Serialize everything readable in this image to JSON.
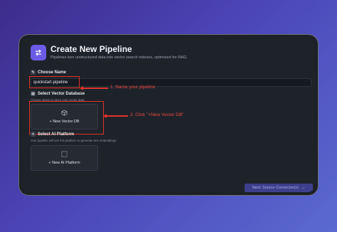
{
  "header": {
    "title": "Create New Pipeline",
    "subtitle": "Pipelines turn unstructured data into vector search indexes, optimized for RAG.",
    "icon": "swap-arrows-icon"
  },
  "name_section": {
    "label": "Choose Name",
    "value": "quickstart-pipeline"
  },
  "vector_section": {
    "label": "Select Vector Database",
    "help": "Choose where to store your vector data.",
    "card_label": "+ New Vector DB"
  },
  "ai_section": {
    "label": "Select AI Platform",
    "help": "Your pipeline will use this platform to generate text embeddings.",
    "card_label": "+ New AI Platform"
  },
  "annotations": {
    "step1": "1. Name your pipeline",
    "step2": "2. Click \"+New Vector DB\""
  },
  "footer": {
    "next_label": "Next: Source Connector(s)",
    "next_arrow": "→"
  },
  "colors": {
    "accent": "#6b5ce7",
    "annotation": "#e0322b"
  }
}
